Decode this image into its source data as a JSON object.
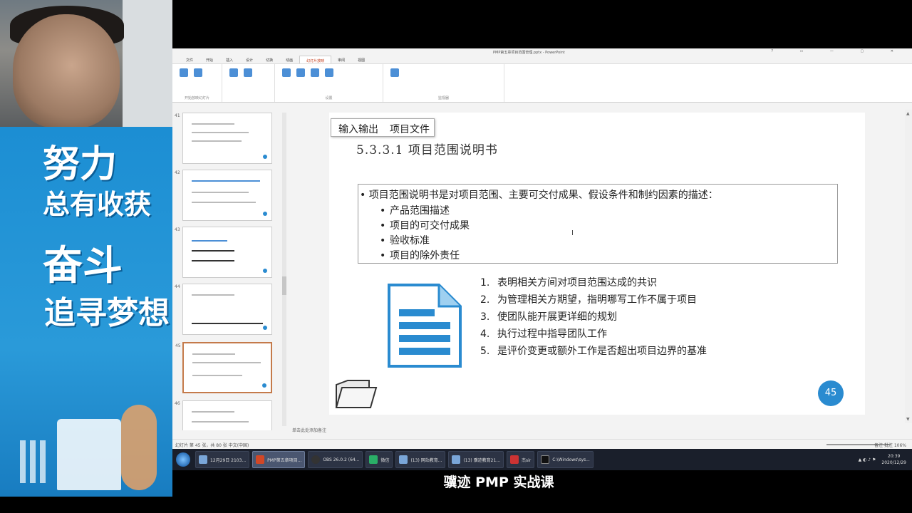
{
  "poster": {
    "word1": "努力",
    "word2": "总有收获",
    "word3": "奋斗",
    "word4": "追寻梦想"
  },
  "window": {
    "title": "PMP第五章项目范围管理.pptx - PowerPoint",
    "controls": "? ▭ — ▢ ✕"
  },
  "ribbon": {
    "tabs": [
      "文件",
      "开始",
      "插入",
      "设计",
      "切换",
      "动画",
      "幻灯片放映",
      "审阅",
      "视图"
    ],
    "active_tab": "幻灯片放映",
    "groups": [
      "开始放映幻灯片",
      "监视器",
      "设置"
    ]
  },
  "thumbnails": [
    {
      "number": "41"
    },
    {
      "number": "42"
    },
    {
      "number": "43"
    },
    {
      "number": "44"
    },
    {
      "number": "45",
      "selected": true
    },
    {
      "number": "46"
    }
  ],
  "slide": {
    "tabs": [
      "输入输出",
      "项目文件"
    ],
    "title": "5.3.3.1 项目范围说明书",
    "definition": "项目范围说明书是对项目范围、主要可交付成果、假设条件和制约因素的描述：",
    "components": [
      "产品范围描述",
      "项目的可交付成果",
      "验收标准",
      "项目的除外责任"
    ],
    "purposes": [
      {
        "num": "1.",
        "text": "表明相关方间对项目范围达成的共识"
      },
      {
        "num": "2.",
        "text": "为管理相关方期望，指明哪写工作不属于项目"
      },
      {
        "num": "3.",
        "text": "使团队能开展更详细的规划"
      },
      {
        "num": "4.",
        "text": "执行过程中指导团队工作"
      },
      {
        "num": "5.",
        "text": "是评价变更或额外工作是否超出项目边界的基准"
      }
    ],
    "page_number": "45",
    "accent_color": "#2a8bd0"
  },
  "notes_placeholder": "单击此处添加备注",
  "statusbar": {
    "left": "幻灯片 第 45 张，共 80 张   中文(中国)",
    "right": "备注   批注   106%"
  },
  "taskbar": {
    "items": [
      "12月29日 2103...",
      "PMP第五章项目...",
      "OBS 26.0.2 (64...",
      "微信",
      "(13) 网站教育...",
      "(13) 骥迹教育21...",
      "杰sir",
      "C:\\Windows\\sys..."
    ],
    "active_index": 1,
    "time": "20:39",
    "date": "2020/12/29"
  },
  "caption": "骥迹 PMP 实战课"
}
